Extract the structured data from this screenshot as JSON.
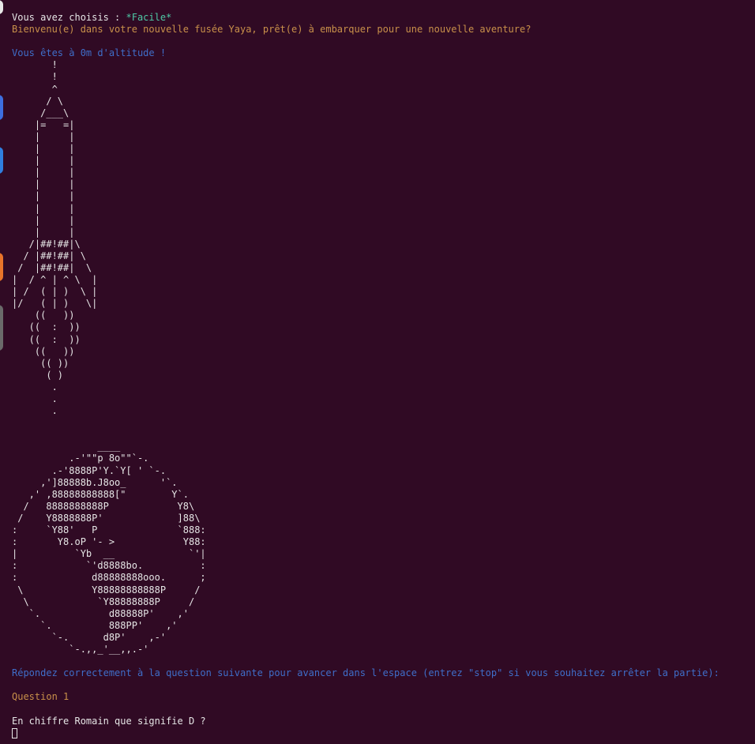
{
  "colors": {
    "background": "#300a24",
    "text": "#e6e6e6",
    "green": "#4ec9a6",
    "orange": "#c8904a",
    "blue": "#3f6ec9"
  },
  "terminal": {
    "choice_prefix": "Vous avez choisis : ",
    "choice_value": "*Facile*",
    "welcome": "Bienvenu(e) dans votre nouvelle fusée Yaya, prêt(e) à embarquer pour une nouvelle aventure?",
    "altitude": "Vous êtes à 0m d'altitude !",
    "rocket_art": "       !\n       !\n       ^\n      / \\\n     /___\\\n    |=   =|\n    |     |\n    |     |\n    |     |\n    |     |\n    |     |\n    |     |\n    |     |\n    |     |\n    |     |\n   /|##!##|\\\n  / |##!##| \\\n /  |##!##|  \\\n|  / ^ | ^ \\  |\n| /  ( | )  \\ |\n|/   ( | )   \\|\n    ((   ))\n   ((  :  ))\n   ((  :  ))\n    ((   ))\n     (( ))\n      ( )\n       .\n       .\n       .",
    "moon_art": "               ____\n          .-'\"\"p 8o\"\"`-.\n       .-'8888P'Y.`Y[ ' `-.\n     ,']88888b.J8oo_      '`.\n   ,' ,88888888888[\"        Y`.\n  /   8888888888P            Y8\\\n /    Y8888888P'             ]88\\\n:     `Y88'   P              `888:\n:       Y8.oP '- >            Y88:\n|          `Yb  __             `'|\n:            `'d8888bo.          :\n:             d88888888ooo.      ;\n \\            Y88888888888P     /\n  \\            `Y88888888P     /\n   `.            d88888P'    ,'\n     `.          888PP'    ,'\n       `-.      d8P'    ,-'\n          `-.,,_'__,,.-'",
    "instruction": "Répondez correctement à la question suivante pour avancer dans l'espace (entrez \"stop\" si vous souhaitez arrêter la partie):",
    "question_label": "Question 1",
    "question_text": "En chiffre Romain que signifie D ?"
  },
  "dock": {
    "icons": [
      "app-icon",
      "app-icon",
      "app-icon",
      "app-icon"
    ]
  }
}
